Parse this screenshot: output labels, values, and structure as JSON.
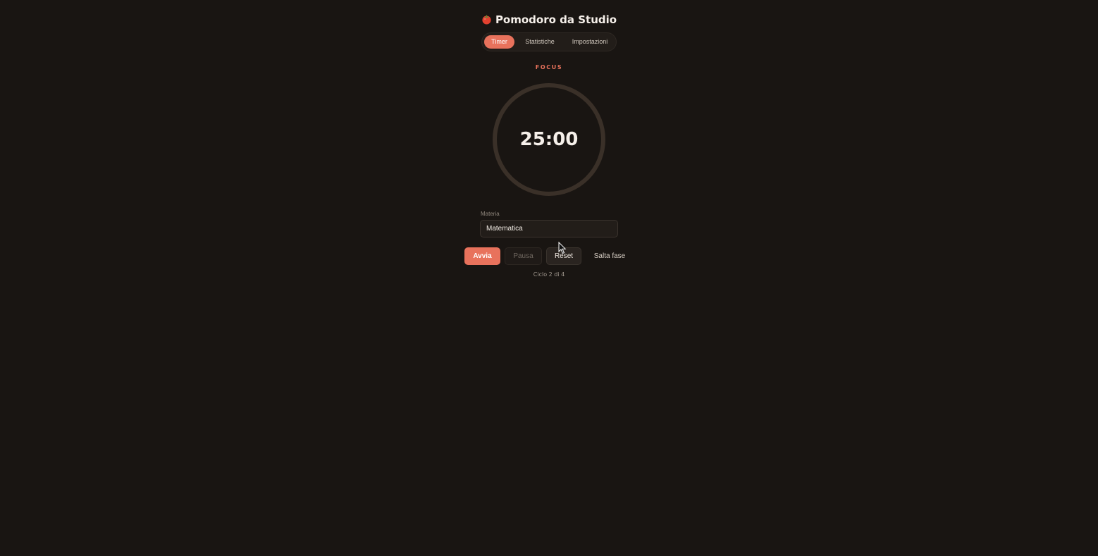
{
  "app": {
    "title": "Pomodoro da Studio",
    "title_icon": "tomato-icon"
  },
  "tabs": [
    {
      "label": "Timer",
      "active": true
    },
    {
      "label": "Statistiche",
      "active": false
    },
    {
      "label": "Impostazioni",
      "active": false
    }
  ],
  "timer": {
    "phase": "FOCUS",
    "time": "25:00",
    "progress": 0
  },
  "subject": {
    "label": "Materia",
    "value": "Matematica"
  },
  "controls": {
    "start": "Avvia",
    "pause": "Pausa",
    "reset": "Reset",
    "skip": "Salta fase"
  },
  "cycle": "Ciclo 2 di 4",
  "colors": {
    "background": "#191512",
    "accent": "#e8725c",
    "ring_track": "#3a3028"
  }
}
